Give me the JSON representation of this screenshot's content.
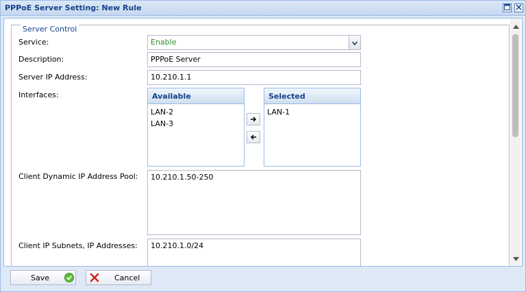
{
  "window": {
    "title": "PPPoE Server Setting: New Rule",
    "icons": [
      "maximize-icon",
      "close-icon"
    ]
  },
  "fieldset": {
    "legend": "Server Control"
  },
  "form": {
    "service": {
      "label": "Service:",
      "value": "Enable"
    },
    "description": {
      "label": "Description:",
      "value": "PPPoE Server"
    },
    "server_ip": {
      "label": "Server IP Address:",
      "value": "10.210.1.1"
    },
    "interfaces": {
      "label": "Interfaces:",
      "available": {
        "header": "Available",
        "items": [
          "LAN-2",
          "LAN-3"
        ]
      },
      "selected": {
        "header": "Selected",
        "items": [
          "LAN-1"
        ]
      }
    },
    "client_pool": {
      "label": "Client Dynamic IP Address Pool:",
      "value": "10.210.1.50-250"
    },
    "client_subnets": {
      "label": "Client IP Subnets, IP Addresses:",
      "value": "10.210.1.0/24"
    }
  },
  "footer": {
    "save_label": "Save",
    "cancel_label": "Cancel"
  },
  "colors": {
    "title": "#15428b",
    "enable_text": "#2e8b2e",
    "border": "#99bbe8"
  }
}
